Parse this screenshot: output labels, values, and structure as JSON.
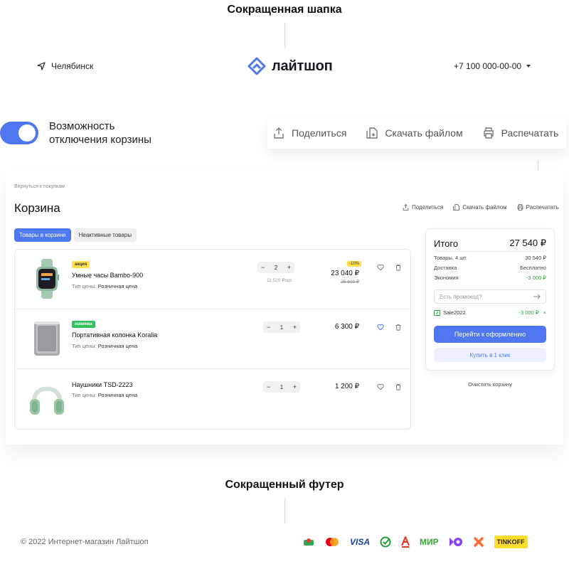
{
  "section_header": {
    "title": "Сокращенная шапка"
  },
  "header": {
    "city": "Челябинск",
    "logo_text": "лайтшоп",
    "phone": "+7 100 000-00-00"
  },
  "toggle": {
    "label_line1": "Возможность",
    "label_line2": "отключения корзины",
    "enabled": true
  },
  "actions": {
    "share": "Поделиться",
    "download": "Скачать файлом",
    "print": "Распечатать"
  },
  "cart": {
    "breadcrumb": "Вернуться к покупкам",
    "title": "Корзина",
    "tabs": [
      {
        "label": "Товары в корзине",
        "active": true
      },
      {
        "label": "Неактивные товары",
        "active": false
      }
    ],
    "price_type_label": "Тип цены:",
    "items": [
      {
        "badge": "акция",
        "badge_type": "sale",
        "name": "Умные часы Bambo-900",
        "price_type": "Розничная цена",
        "qty": "2",
        "unit_price": "11 520 ₽/шт.",
        "discount": "-10%",
        "price": "23 040 ₽",
        "old_price": "25 600 ₽",
        "favorite": false
      },
      {
        "badge": "новинка",
        "badge_type": "new",
        "name": "Портативная колонка Koralia",
        "price_type": "Розничная цена",
        "qty": "1",
        "price": "6 300 ₽",
        "favorite": true
      },
      {
        "name": "Наушники TSD-2223",
        "price_type": "Розничная цена",
        "qty": "1",
        "price": "1 200 ₽",
        "favorite": false
      }
    ]
  },
  "summary": {
    "title": "Итого",
    "total": "27 540 ₽",
    "rows": [
      {
        "label": "Товары, 4 шт.",
        "value": "30 540 ₽"
      },
      {
        "label": "Доставка",
        "value": "Бесплатно"
      },
      {
        "label": "Экономия",
        "value": "-3 000 ₽"
      }
    ],
    "promo_placeholder": "Есть промокод?",
    "applied_code": "Sale2022",
    "applied_value": "-3 000 ₽",
    "checkout_button": "Перейти к оформлению",
    "one_click_button": "Купить в 1 клик",
    "clear_cart": "Очистить корзину"
  },
  "section_footer": {
    "title": "Сокращенный футер"
  },
  "footer": {
    "copyright": "© 2022 Интернет-магазин Лайтшоп",
    "payment_icons": [
      "green-payment-icon",
      "mastercard-icon",
      "VISA",
      "sber-icon",
      "alfa-icon",
      "МИР",
      "yoomoney-icon",
      "qiwi-icon",
      "TINKOFF"
    ]
  },
  "colors": {
    "accent": "#4f78f0",
    "green": "#22a63a",
    "sale_badge": "#ffe14d",
    "new_badge": "#2fc25b"
  }
}
